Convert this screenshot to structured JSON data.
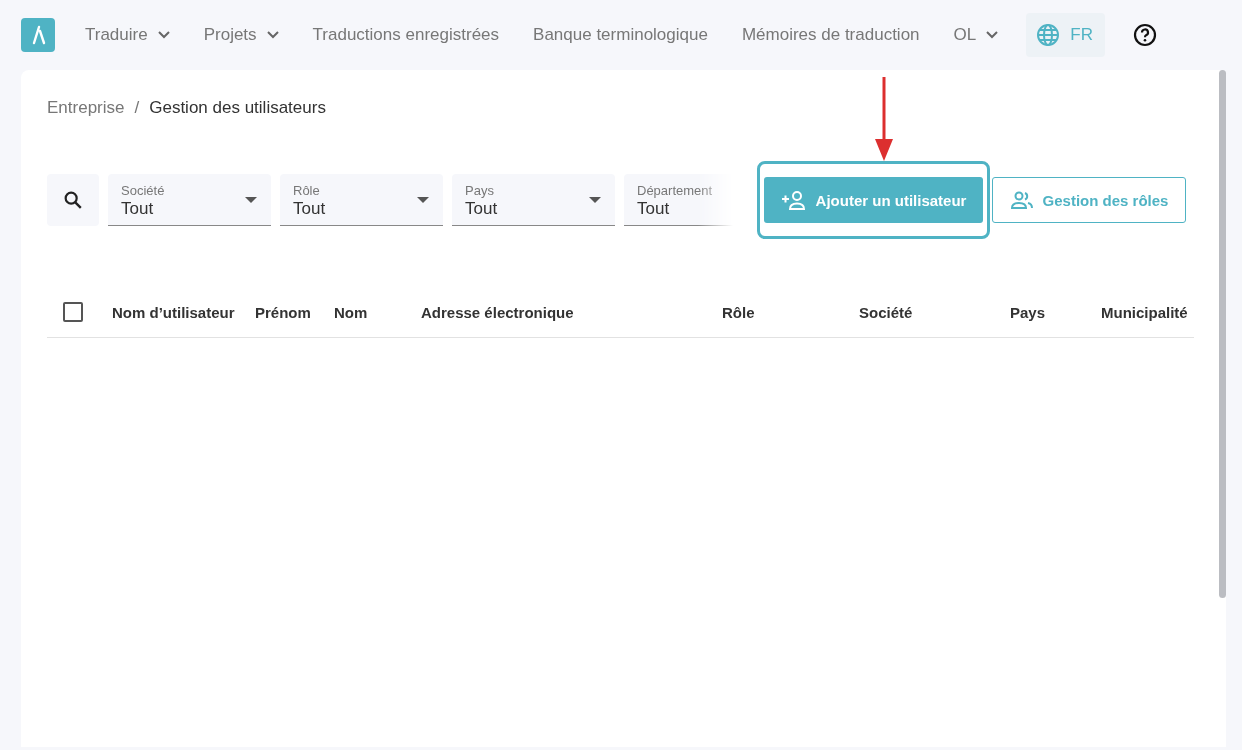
{
  "nav": {
    "items": [
      {
        "label": "Traduire",
        "dropdown": true
      },
      {
        "label": "Projets",
        "dropdown": true
      },
      {
        "label": "Traductions enregistrées",
        "dropdown": false
      },
      {
        "label": "Banque terminologique",
        "dropdown": false
      },
      {
        "label": "Mémoires de traduction",
        "dropdown": false
      },
      {
        "label": "OL",
        "dropdown": true
      }
    ],
    "language": "FR"
  },
  "breadcrumb": {
    "items": [
      "Entreprise",
      "Gestion des utilisateurs"
    ],
    "separator": "/"
  },
  "filters": [
    {
      "label": "Société",
      "value": "Tout",
      "caret": true
    },
    {
      "label": "Rôle",
      "value": "Tout",
      "caret": true
    },
    {
      "label": "Pays",
      "value": "Tout",
      "caret": true
    },
    {
      "label": "Département",
      "value": "Tout",
      "caret": false
    }
  ],
  "buttons": [
    {
      "label": "Ajouter un utilisateur",
      "kind": "primary",
      "highlighted": true
    },
    {
      "label": "Gestion des rôles",
      "kind": "secondary",
      "highlighted": false
    }
  ],
  "table": {
    "select_all": {
      "checked": false
    },
    "columns": [
      "Nom d’utilisateur",
      "Prénom",
      "Nom",
      "Adresse électronique",
      "Rôle",
      "Société",
      "Pays",
      "Municipalité"
    ]
  }
}
